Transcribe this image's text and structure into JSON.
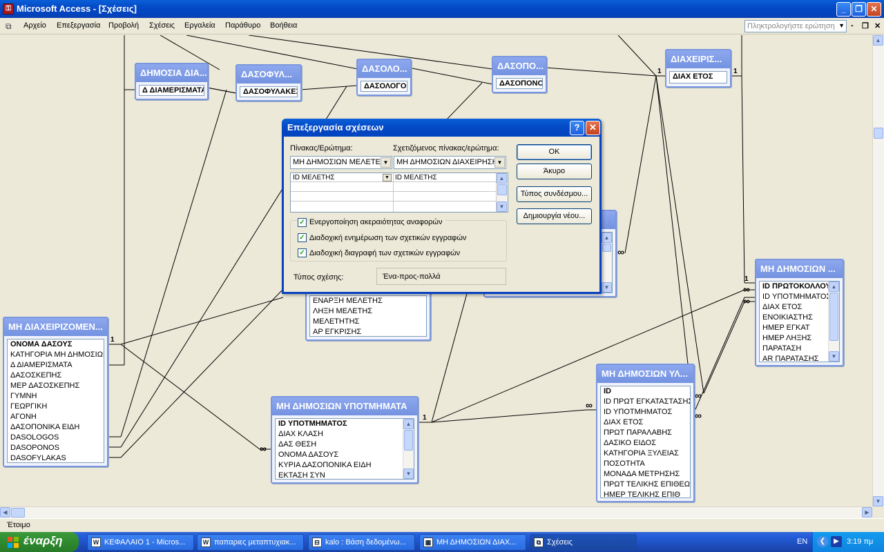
{
  "window": {
    "app_icon": "key-icon",
    "title": "Microsoft Access - [Σχέσεις]",
    "controls": [
      "_",
      "❐",
      "✕"
    ]
  },
  "menu": {
    "items": [
      "Αρχείο",
      "Επεξεργασία",
      "Προβολή",
      "Σχέσεις",
      "Εργαλεία",
      "Παράθυρο",
      "Βοήθεια"
    ],
    "ask_placeholder": "Πληκτρολογήστε ερώτηση",
    "mdi_controls": [
      "-",
      "❐",
      "✕"
    ]
  },
  "tables": {
    "dimosia_diam": {
      "title": "ΔΗΜΟΣΙΑ ΔΙΑ...",
      "fields": [
        "Δ ΔΙΑΜΕΡΙΣΜΑΤΑ"
      ]
    },
    "dasofylakes": {
      "title": "ΔΑΣΟΦΥΛ...",
      "fields": [
        "ΔΑΣΟΦΥΛΑΚΕΣ"
      ]
    },
    "dasologoi": {
      "title": "ΔΑΣΟΛΟ...",
      "fields": [
        "ΔΑΣΟΛΟΓΟΙ"
      ]
    },
    "dasoponoi": {
      "title": "ΔΑΣΟΠΟ...",
      "fields": [
        "ΔΑΣΟΠΟΝΟΙ"
      ]
    },
    "diaxeiris": {
      "title": "ΔΙΑΧΕΙΡΙΣ...",
      "fields": [
        "ΔΙΑΧ ΕΤΟΣ"
      ]
    },
    "mh_diaxeirizomen": {
      "title": "ΜΗ ΔΙΑΧΕΙΡΙΖΟΜΕΝ...",
      "fields": [
        "ΟΝΟΜΑ ΔΑΣΟΥΣ",
        "ΚΑΤΗΓΟΡΙΑ ΜΗ ΔΗΜΟΣΙΩΝ Δ",
        "Δ ΔΙΑΜΕΡΙΣΜΑΤΑ",
        "ΔΑΣΟΣΚΕΠΗΣ",
        "ΜΕΡ ΔΑΣΟΣΚΕΠΗΣ",
        "ΓΥΜΝΗ",
        "ΓΕΩΡΓΙΚΗ",
        "ΑΓΟΝΗ",
        "ΔΑΣΟΠΟΝΙΚΑ ΕΙΔΗ",
        "DASOLOGOS",
        "DASOPONOS",
        "DASOFYLAKAS"
      ]
    },
    "meletes": {
      "title": "",
      "fields": [
        "ΕΝΑΡΞΗ ΜΕΛΕΤΗΣ",
        "ΛΗΞΗ ΜΕΛΕΤΗΣ",
        "ΜΕΛΕΤΗΤΗΣ",
        "ΑΡ ΕΓΚΡΙΣΗΣ"
      ]
    },
    "ypotmimata": {
      "title": "ΜΗ ΔΗΜΟΣΙΩΝ ΥΠΟΤΜΗΜΑΤΑ",
      "fields": [
        "ID ΥΠΟΤΜΗΜΑΤΟΣ",
        "ΔΙΑΧ ΚΛΑΣΗ",
        "ΔΑΣ ΘΕΣΗ",
        "ΟΝΟΜΑ ΔΑΣΟΥΣ",
        "ΚΥΡΙΑ ΔΑΣΟΠΟΝΙΚΑ ΕΙΔΗ",
        "ΕΚΤΑΣΗ ΣΥΝ"
      ]
    },
    "ylotomia": {
      "title": "ΜΗ ΔΗΜΟΣΙΩΝ ΥΛ...",
      "fields": [
        "ID",
        "ID ΠΡΩΤ ΕΓΚΑΤΑΣΤΑΣΗΣ",
        "ID ΥΠΟΤΜΗΜΑΤΟΣ",
        "ΔΙΑΧ ΕΤΟΣ",
        "ΠΡΩΤ ΠΑΡΑΛΑΒΗΣ",
        "ΔΑΣΙΚΟ ΕΙΔΟΣ",
        "ΚΑΤΗΓΟΡΙΑ ΞΥΛΕΙΑΣ",
        "ΠΟΣΟΤΗΤΑ",
        "ΜΟΝΑΔΑ ΜΕΤΡΗΣΗΣ",
        "ΠΡΩΤ ΤΕΛΙΚΗΣ ΕΠΙΘΕΩΡΗΣ",
        "ΗΜΕΡ ΤΕΛΙΚΗΣ ΕΠΙΘ"
      ]
    },
    "mh_dimosion": {
      "title": "ΜΗ ΔΗΜΟΣΙΩΝ ...",
      "fields": [
        "ID ΠΡΩΤΟΚΟΛΛΟΥ",
        "ID ΥΠΟΤΜΗΜΑΤΟΣ",
        "ΔΙΑΧ ΕΤΟΣ",
        "ΕΝΟΙΚΙΑΣΤΗΣ",
        "ΗΜΕΡ ΕΓΚΑΤ",
        "ΗΜΕΡ ΛΗΞΗΣ",
        "ΠΑΡΑΤΑΣΗ",
        "ΑR ΠΑΡΑΤΑΣΗΣ"
      ]
    }
  },
  "join_labels": {
    "one": "1",
    "many": "∞"
  },
  "dialog": {
    "title": "Επεξεργασία σχέσεων",
    "table_label": "Πίνακας/Ερώτημα:",
    "related_label": "Σχετιζόμενος πίνακας/ερώτημα:",
    "table_value": "ΜΗ ΔΗΜΟΣΙΩΝ ΜΕΛΕΤΕΣ",
    "related_value": "ΜΗ ΔΗΜΟΣΙΩΝ ΔΙΑΧΕΙΡΗΣΗ",
    "field_left": "ID ΜΕΛΕΤΗΣ",
    "field_right": "ID ΜΕΛΕΤΗΣ",
    "buttons": {
      "ok": "ΟΚ",
      "cancel": "Άκυρο",
      "join_type": "Τύπος συνδέσμου...",
      "create_new": "Δημιουργία νέου..."
    },
    "enforce_label": "Ενεργοποίηση ακεραιότητας αναφορών",
    "cascade_update_label": "Διαδοχική ενημέρωση των σχετικών εγγραφών",
    "cascade_delete_label": "Διαδοχική διαγραφή των σχετικών εγγραφών",
    "enforce_checked": true,
    "cascade_update_checked": true,
    "cascade_delete_checked": true,
    "relationship_type_label": "Τύπος σχέσης:",
    "relationship_type_value": "Ένα-προς-πολλά"
  },
  "status": "Έτοιμο",
  "taskbar": {
    "start_label": "έναρξη",
    "tasks": [
      {
        "label": "ΚΕΦΑΛΑΙΟ 1 - Micros...",
        "icon": "word-icon"
      },
      {
        "label": "παπαριες μεταπτυχιακ...",
        "icon": "word-icon"
      },
      {
        "label": "kalo : Βάση δεδομένω...",
        "icon": "database-icon"
      },
      {
        "label": "ΜΗ ΔΗΜΟΣΙΩΝ ΔΙΑΧ...",
        "icon": "table-icon"
      },
      {
        "label": "Σχέσεις",
        "icon": "relationships-icon"
      }
    ],
    "language": "EN",
    "clock": "3:19 πμ"
  },
  "colors": {
    "title_blue": "#0449c5",
    "table_header": "#7f9be6",
    "start_green": "#2f8a2f"
  }
}
